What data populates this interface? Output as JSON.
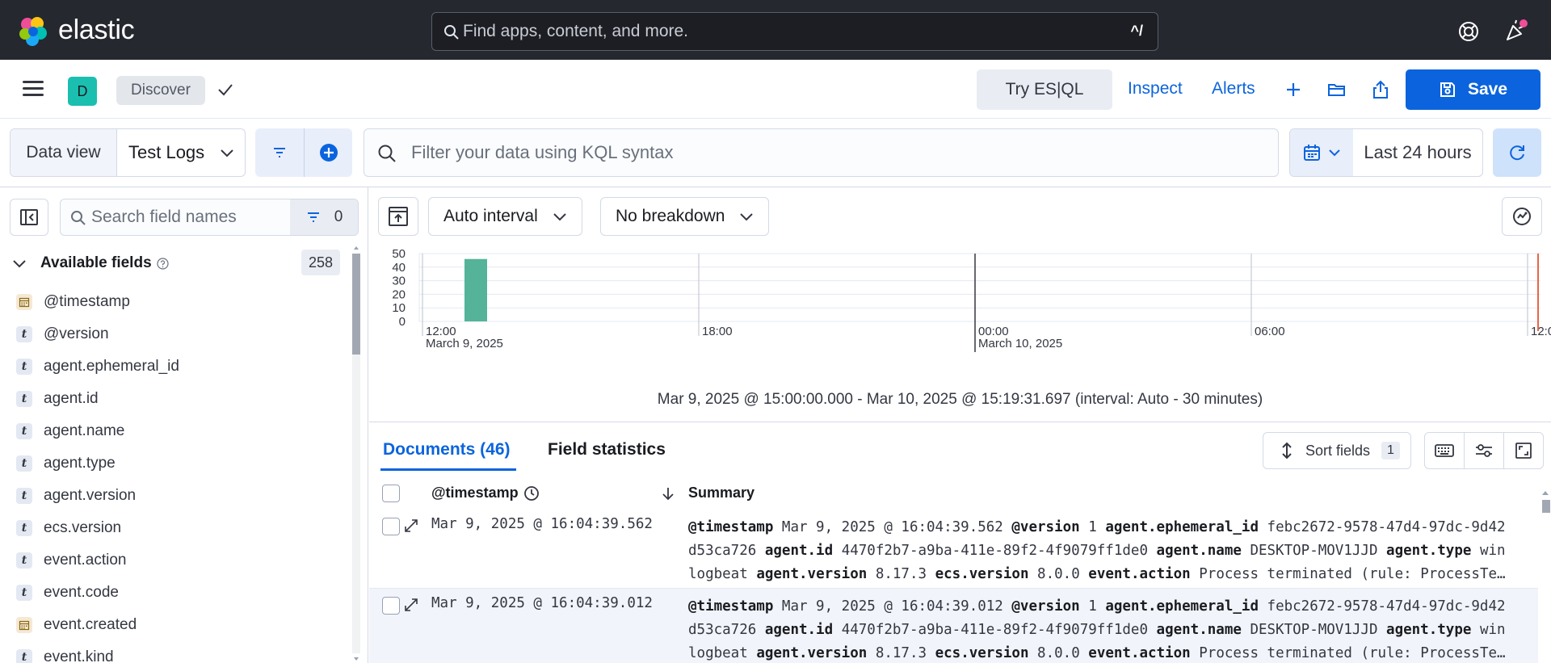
{
  "header": {
    "logo_text": "elastic",
    "search_placeholder": "Find apps, content, and more.",
    "search_shortcut": "^/"
  },
  "appbar": {
    "space_initial": "D",
    "breadcrumb": "Discover",
    "try_esql": "Try ES|QL",
    "inspect": "Inspect",
    "alerts": "Alerts",
    "save": "Save"
  },
  "query": {
    "data_view_label": "Data view",
    "data_view_value": "Test Logs",
    "kql_placeholder": "Filter your data using KQL syntax",
    "time_range": "Last 24 hours"
  },
  "sidebar": {
    "search_placeholder": "Search field names",
    "filter_count": "0",
    "available_title": "Available fields",
    "available_count": "258",
    "fields": [
      {
        "name": "@timestamp",
        "type": "date"
      },
      {
        "name": "@version",
        "type": "string"
      },
      {
        "name": "agent.ephemeral_id",
        "type": "string"
      },
      {
        "name": "agent.id",
        "type": "string"
      },
      {
        "name": "agent.name",
        "type": "string"
      },
      {
        "name": "agent.type",
        "type": "string"
      },
      {
        "name": "agent.version",
        "type": "string"
      },
      {
        "name": "ecs.version",
        "type": "string"
      },
      {
        "name": "event.action",
        "type": "string"
      },
      {
        "name": "event.code",
        "type": "string"
      },
      {
        "name": "event.created",
        "type": "date"
      },
      {
        "name": "event.kind",
        "type": "string"
      }
    ],
    "type_glyph": "t"
  },
  "histogram": {
    "interval_label": "Auto interval",
    "breakdown_label": "No breakdown",
    "range_text": "Mar 9, 2025 @ 15:00:00.000 - Mar 10, 2025 @ 15:19:31.697 (interval: Auto - 30 minutes)",
    "bar_color": "#54b399"
  },
  "chart_data": {
    "type": "bar",
    "y_ticks": [
      "50",
      "40",
      "30",
      "20",
      "10",
      "0"
    ],
    "ylim": [
      0,
      50
    ],
    "x_ticks": [
      {
        "label": "12:00",
        "sublabel": "March 9, 2025"
      },
      {
        "label": "18:00",
        "sublabel": ""
      },
      {
        "label": "00:00",
        "sublabel": "March 10, 2025"
      },
      {
        "label": "06:00",
        "sublabel": ""
      },
      {
        "label": "12:00",
        "sublabel": ""
      }
    ],
    "bars": [
      {
        "x": "2025-03-09 16:00",
        "value": 46
      }
    ],
    "grid": true
  },
  "documents": {
    "tab_documents": "Documents (46)",
    "tab_field_stats": "Field statistics",
    "sort_label": "Sort fields",
    "sort_count": "1",
    "col_timestamp": "@timestamp",
    "col_summary": "Summary",
    "rows": [
      {
        "timestamp": "Mar 9, 2025 @ 16:04:39.562",
        "lines": [
          [
            [
              "@timestamp",
              "Mar 9, 2025 @ 16:04:39.562"
            ],
            [
              "@version",
              "1"
            ],
            [
              "agent.ephemeral_id",
              "febc2672-9578-47d4-97dc-9d42"
            ]
          ],
          [
            [
              "",
              "d53ca726"
            ],
            [
              "agent.id",
              "4470f2b7-a9ba-411e-89f2-4f9079ff1de0"
            ],
            [
              "agent.name",
              "DESKTOP-MOV1JJD"
            ],
            [
              "agent.type",
              "win"
            ]
          ],
          [
            [
              "",
              "logbeat"
            ],
            [
              "agent.version",
              "8.17.3"
            ],
            [
              "ecs.version",
              "8.0.0"
            ],
            [
              "event.action",
              "Process terminated (rule: ProcessTe…"
            ]
          ]
        ]
      },
      {
        "timestamp": "Mar 9, 2025 @ 16:04:39.012",
        "lines": [
          [
            [
              "@timestamp",
              "Mar 9, 2025 @ 16:04:39.012"
            ],
            [
              "@version",
              "1"
            ],
            [
              "agent.ephemeral_id",
              "febc2672-9578-47d4-97dc-9d42"
            ]
          ],
          [
            [
              "",
              "d53ca726"
            ],
            [
              "agent.id",
              "4470f2b7-a9ba-411e-89f2-4f9079ff1de0"
            ],
            [
              "agent.name",
              "DESKTOP-MOV1JJD"
            ],
            [
              "agent.type",
              "win"
            ]
          ],
          [
            [
              "",
              "logbeat"
            ],
            [
              "agent.version",
              "8.17.3"
            ],
            [
              "ecs.version",
              "8.0.0"
            ],
            [
              "event.action",
              "Process terminated (rule: ProcessTe…"
            ]
          ]
        ]
      }
    ]
  }
}
